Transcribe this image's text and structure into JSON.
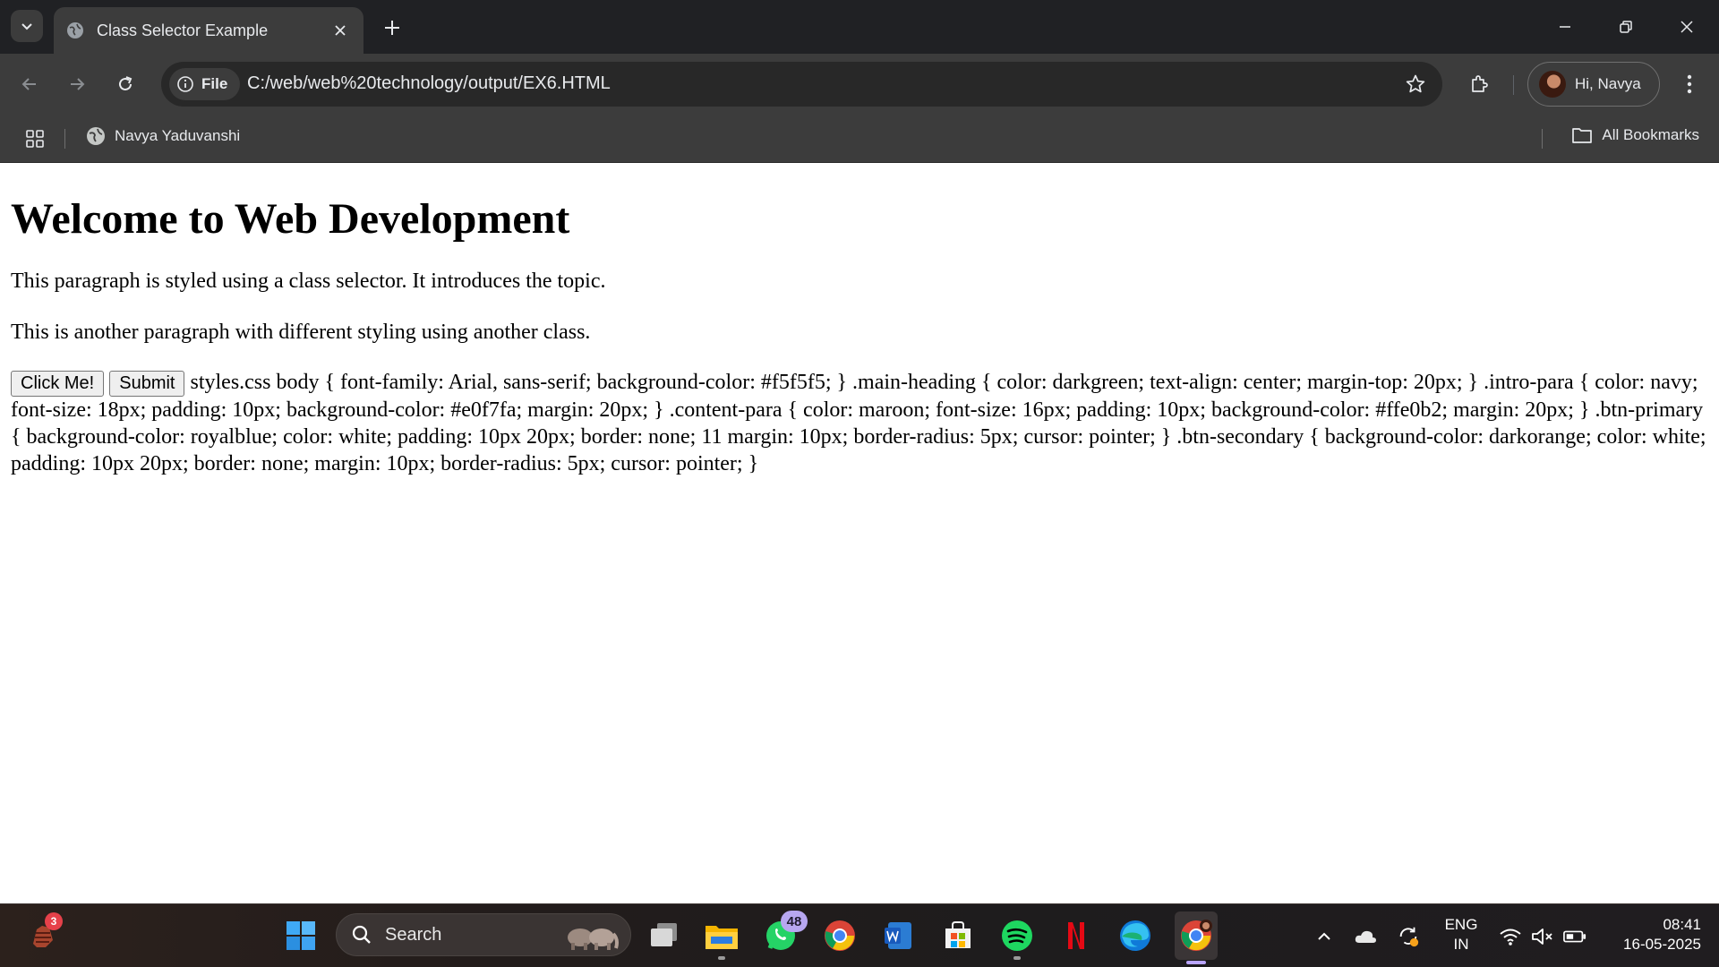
{
  "browser": {
    "tab_title": "Class Selector Example",
    "site_info_label": "File",
    "url": "C:/web/web%20technology/output/EX6.HTML",
    "profile_label": "Hi, Navya",
    "bookmark_item": "Navya Yaduvanshi",
    "all_bookmarks": "All Bookmarks"
  },
  "page": {
    "heading": "Welcome to Web Development",
    "intro_para": "This paragraph is styled using a class selector. It introduces the topic.",
    "content_para": "This is another paragraph with different styling using another class.",
    "button_primary": "Click Me!",
    "button_secondary": "Submit",
    "css_text": "styles.css body { font-family: Arial, sans-serif; background-color: #f5f5f5; } .main-heading { color: darkgreen; text-align: center; margin-top: 20px; } .intro-para { color: navy; font-size: 18px; padding: 10px; background-color: #e0f7fa; margin: 20px; } .content-para { color: maroon; font-size: 16px; padding: 10px; background-color: #ffe0b2; margin: 20px; } .btn-primary { background-color: royalblue; color: white; padding: 10px 20px; border: none; 11 margin: 10px; border-radius: 5px; cursor: pointer; } .btn-secondary { background-color: darkorange; color: white; padding: 10px 20px; border: none; margin: 10px; border-radius: 5px; cursor: pointer; }"
  },
  "taskbar": {
    "search_placeholder": "Search",
    "notification_badge": "3",
    "whatsapp_badge": "48",
    "lang_line1": "ENG",
    "lang_line2": "IN",
    "time": "08:41",
    "date": "16-05-2025",
    "pinned": [
      "start-icon",
      "file-explorer-icon",
      "whatsapp-icon",
      "chrome-icon",
      "word-icon",
      "store-icon",
      "spotify-icon",
      "netflix-icon",
      "edge-icon",
      "chrome-profile-icon"
    ]
  },
  "colors": {
    "tabstrip_bg": "#202124",
    "toolbar_bg": "#3c3c3c",
    "page_bg": "#ffffff",
    "badge_red": "#e6414a",
    "badge_purple": "#b7a7f0"
  }
}
